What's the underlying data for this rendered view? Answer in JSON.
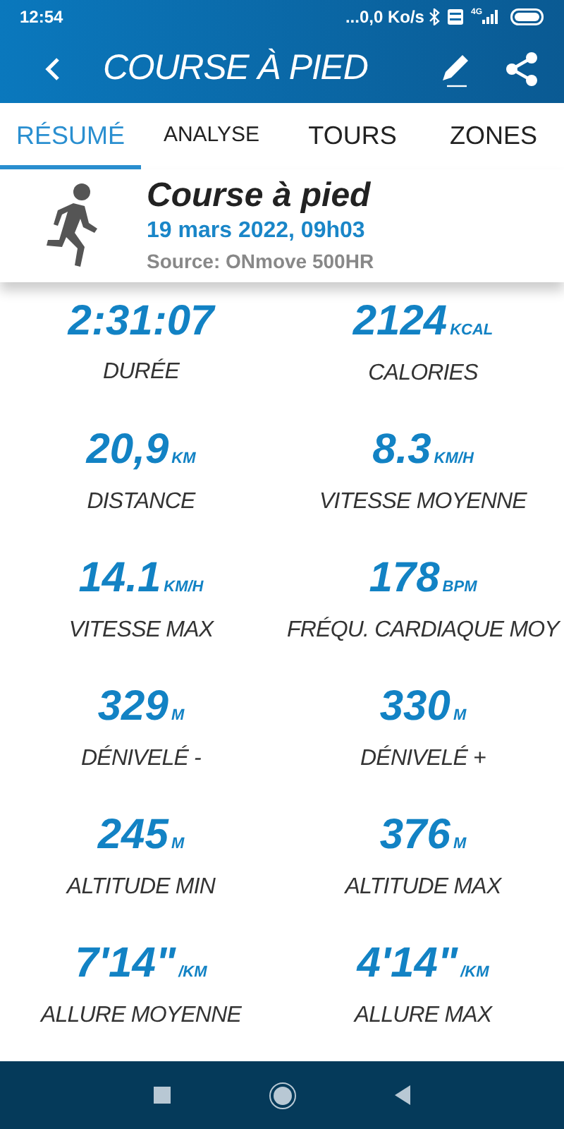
{
  "status_bar": {
    "time": "12:54",
    "speed": "...0,0 Ko/s",
    "network": "4G"
  },
  "header": {
    "title": "COURSE À PIED"
  },
  "tabs": [
    {
      "label": "RÉSUMÉ",
      "selected": true
    },
    {
      "label": "ANALYSE",
      "selected": false
    },
    {
      "label": "TOURS",
      "selected": false
    },
    {
      "label": "ZONES",
      "selected": false
    }
  ],
  "activity": {
    "name": "Course à pied",
    "date": "19 mars 2022, 09h03",
    "source": "Source: ONmove 500HR"
  },
  "stats": [
    {
      "value": "2:31:07",
      "label": "DURÉE"
    },
    {
      "value": "2124",
      "unit": "KCAL",
      "label": "CALORIES"
    },
    {
      "value": "20,9",
      "unit": "KM",
      "label": "DISTANCE"
    },
    {
      "value": "8.3",
      "unit": "KM/H",
      "label": "VITESSE MOYENNE"
    },
    {
      "value": "14.1",
      "unit": "KM/H",
      "label": "VITESSE MAX"
    },
    {
      "value": "178",
      "unit": "BPM",
      "label": "FRÉQU. CARDIAQUE MOY"
    },
    {
      "value": "329",
      "unit": "M",
      "label": "DÉNIVELÉ -"
    },
    {
      "value": "330",
      "unit": "M",
      "label": "DÉNIVELÉ +"
    },
    {
      "value": "245",
      "unit": "M",
      "label": "ALTITUDE MIN"
    },
    {
      "value": "376",
      "unit": "M",
      "label": "ALTITUDE MAX"
    },
    {
      "value": "7'14\"",
      "unit": "/KM",
      "label": "ALLURE MOYENNE"
    },
    {
      "value": "4'14\"",
      "unit": "/KM",
      "label": "ALLURE MAX"
    }
  ]
}
